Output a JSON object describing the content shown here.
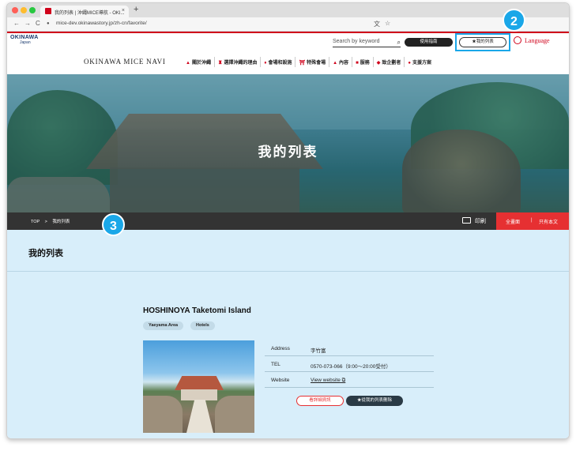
{
  "browser": {
    "tab_title": "我的列表 | 沖繩MICE導航 - OKI...",
    "tab_close": "×",
    "new_tab": "+",
    "url": "mice-dev.okinawastory.jp/zh-cn/favorite/",
    "back": "←",
    "forward": "→",
    "reload": "C",
    "translate_icon": "文",
    "star_icon": "☆",
    "menu_icon": "⋮",
    "dot_colors": [
      "#ff5f57",
      "#febc2e",
      "#28c840"
    ]
  },
  "header": {
    "logo_name": "OKINAWA",
    "logo_sub": "Japan",
    "logo_tag": "Where inspiration meets",
    "search_placeholder": "Search by keyword",
    "search_icon": "⌕",
    "guide_button": "使用指南",
    "favorite_button": "★我的列表",
    "language": "Language",
    "site_title": "OKINAWA MICE NAVI",
    "nav": [
      {
        "icon": "▲",
        "label": "關於沖繩"
      },
      {
        "icon": "♜",
        "label": "選擇沖繩的理由"
      },
      {
        "icon": "♦",
        "label": "會場和設施"
      },
      {
        "icon": "⛩",
        "label": "特殊會場"
      },
      {
        "icon": "▲",
        "label": "內容"
      },
      {
        "icon": "■",
        "label": "服務"
      },
      {
        "icon": "◆",
        "label": "致企劃者"
      },
      {
        "icon": "●",
        "label": "支援方案"
      }
    ]
  },
  "hero": {
    "title": "我的列表"
  },
  "breadcrumb": {
    "home": "TOP",
    "sep": ">",
    "current": "我的列表"
  },
  "toolbar": {
    "print": "印刷",
    "full_screen": "全畫面",
    "divider": "|",
    "text_only": "只有本文"
  },
  "annotations": {
    "badge_2": "2",
    "badge_3": "3",
    "badge_color": "#1aa7e8"
  },
  "page": {
    "heading": "我的列表"
  },
  "item": {
    "title": "HOSHINOYA Taketomi Island",
    "tags": [
      "Yaeyama Area",
      "Hotels"
    ],
    "details": [
      {
        "key": "Address",
        "value": "字竹富"
      },
      {
        "key": "TEL",
        "value": "0570-073-066（9:00〜20:00受付）"
      },
      {
        "key": "Website",
        "value": "View website"
      }
    ],
    "external_icon": "⧉",
    "detail_button": "看詳細資訊",
    "remove_button": "★從我的列表刪除"
  },
  "colors": {
    "accent_red": "#d0021b",
    "button_red": "#e63032",
    "content_bg": "#d8eefa"
  }
}
